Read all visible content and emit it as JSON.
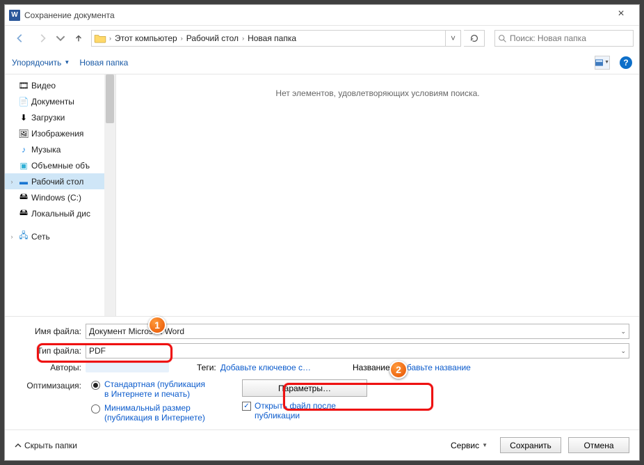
{
  "window": {
    "title": "Сохранение документа"
  },
  "breadcrumb": {
    "root": "Этот компьютер",
    "mid": "Рабочий стол",
    "leaf": "Новая папка"
  },
  "search": {
    "placeholder": "Поиск: Новая папка"
  },
  "toolbar": {
    "organize": "Упорядочить",
    "newfolder": "Новая папка"
  },
  "tree": {
    "items": [
      {
        "label": "Видео"
      },
      {
        "label": "Документы"
      },
      {
        "label": "Загрузки"
      },
      {
        "label": "Изображения"
      },
      {
        "label": "Музыка"
      },
      {
        "label": "Объемные объ"
      },
      {
        "label": "Рабочий стол"
      },
      {
        "label": "Windows (C:)"
      },
      {
        "label": "Локальный дис"
      },
      {
        "label": "Сеть"
      }
    ]
  },
  "listing": {
    "empty": "Нет элементов, удовлетворяющих условиям поиска."
  },
  "form": {
    "fname_label": "Имя файла:",
    "fname_value": "Документ Microsoft Word",
    "ftype_label": "Тип файла:",
    "ftype_value": "PDF",
    "authors_label": "Авторы:",
    "tags_label": "Теги:",
    "tags_hint": "Добавьте ключевое с…",
    "title_label": "Название:",
    "title_hint": "Добавьте название",
    "optimize_label": "Оптимизация:",
    "opt_std": "Стандартная (публикация в Интернете и печать)",
    "opt_min": "Минимальный размер (публикация в Интернете)",
    "params_btn": "Параметры…",
    "open_after": "Открыть файл после публикации"
  },
  "bottombar": {
    "hide": "Скрыть папки",
    "service": "Сервис",
    "save": "Сохранить",
    "cancel": "Отмена"
  },
  "bubbles": {
    "one": "1",
    "two": "2"
  }
}
